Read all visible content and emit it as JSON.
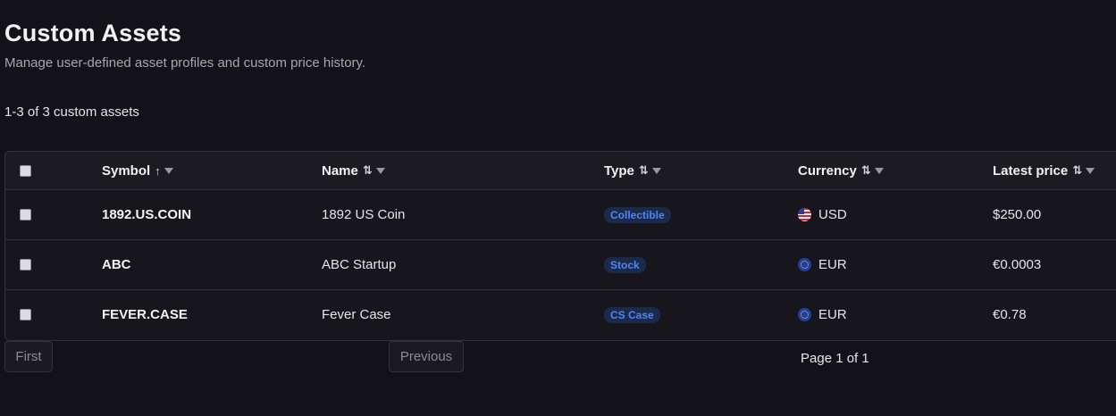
{
  "header": {
    "title": "Custom Assets",
    "subtitle": "Manage user-defined asset profiles and custom price history."
  },
  "summary": {
    "count_text": "1-3 of 3 custom assets"
  },
  "table": {
    "columns": [
      {
        "label": "Symbol",
        "sort_icon": "↑"
      },
      {
        "label": "Name",
        "sort_icon": "⇅"
      },
      {
        "label": "Type",
        "sort_icon": "⇅"
      },
      {
        "label": "Currency",
        "sort_icon": "⇅"
      },
      {
        "label": "Latest price",
        "sort_icon": "⇅"
      }
    ],
    "rows": [
      {
        "symbol": "1892.US.COIN",
        "name": "1892 US Coin",
        "type": "Collectible",
        "currency": "USD",
        "flag": "us-flag-icon",
        "price": "$250.00"
      },
      {
        "symbol": "ABC",
        "name": "ABC Startup",
        "type": "Stock",
        "currency": "EUR",
        "flag": "eu-flag-icon",
        "price": "€0.0003"
      },
      {
        "symbol": "FEVER.CASE",
        "name": "Fever Case",
        "type": "CS Case",
        "currency": "EUR",
        "flag": "eu-flag-icon",
        "price": "€0.78"
      }
    ]
  },
  "pagination": {
    "first_label": "First",
    "previous_label": "Previous",
    "page_text": "Page 1 of 1"
  },
  "colors": {
    "background": "#141219",
    "badge_text": "#4f86f4",
    "badge_bg": "#1c2a4a"
  }
}
